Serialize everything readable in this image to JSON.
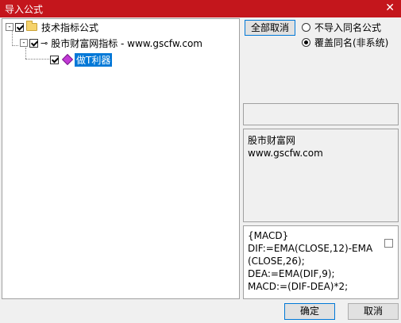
{
  "window": {
    "title": "导入公式",
    "close_glyph": "✕"
  },
  "tree": {
    "root": {
      "expander": "-",
      "label": "技术指标公式",
      "checked": true
    },
    "group": {
      "expander": "-",
      "label": "股市财富网指标 - www.gscfw.com",
      "checked": true
    },
    "item": {
      "label": "做T利器",
      "checked": true,
      "selected": true
    }
  },
  "options": {
    "deselect_all_label": "全部取消",
    "radio_skip_label": "不导入同名公式",
    "radio_overwrite_label": "覆盖同名(非系统)",
    "selected_radio": "overwrite"
  },
  "description_panel": {
    "text": "股市财富网\nwww.gscfw.com"
  },
  "formula_panel": {
    "text": "{MACD}\nDIF:=EMA(CLOSE,12)-EMA\n(CLOSE,26);\nDEA:=EMA(DIF,9);\nMACD:=(DIF-DEA)*2;"
  },
  "buttons": {
    "ok_label": "确定",
    "cancel_label": "取消"
  }
}
